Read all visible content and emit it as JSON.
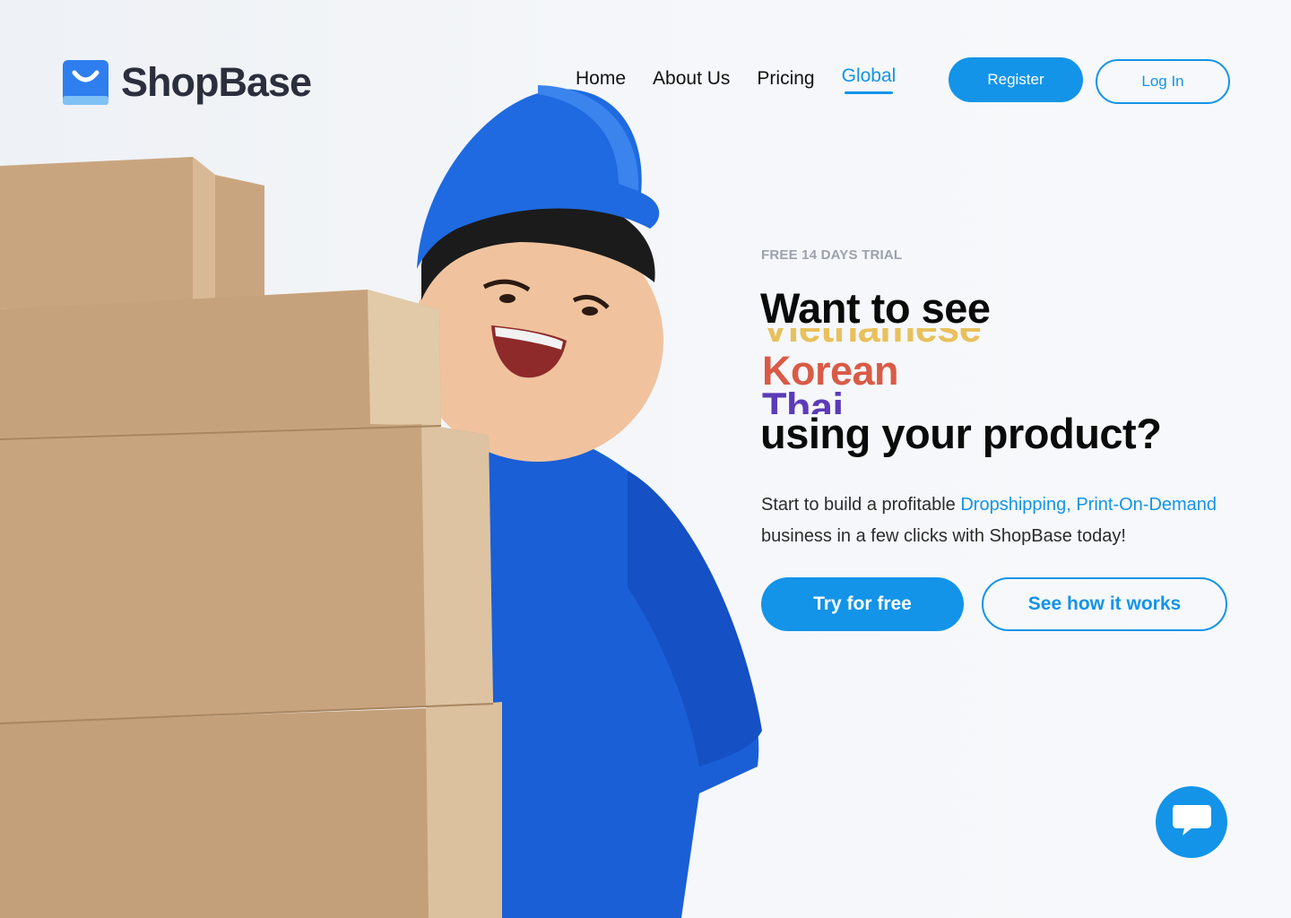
{
  "brand": {
    "name": "ShopBase",
    "accent": "#1394e8",
    "logo_icon": "shopping-bag-icon"
  },
  "nav": {
    "items": [
      {
        "label": "Home",
        "active": false
      },
      {
        "label": "About Us",
        "active": false
      },
      {
        "label": "Pricing",
        "active": false
      },
      {
        "label": "Global",
        "active": true
      }
    ]
  },
  "header": {
    "register_label": "Register",
    "login_label": "Log In"
  },
  "hero": {
    "eyebrow": "FREE 14 DAYS TRIAL",
    "headline_top": "Want to see",
    "rotating_words": [
      {
        "text": "Vietnamese",
        "color": "#e8c15c"
      },
      {
        "text": "Korean",
        "color": "#d95b46"
      },
      {
        "text": "Thai",
        "color": "#5b3bb8"
      }
    ],
    "headline_bottom": "using your product?",
    "desc_1": "Start to build a profitable ",
    "desc_hl": "Dropshipping, Print-On-Demand",
    "desc_2": " business in a few clicks with ShopBase today!",
    "cta_primary": "Try for free",
    "cta_secondary": "See how it works",
    "image": "delivery-person-holding-boxes"
  },
  "chat": {
    "icon": "chat-bubble-icon"
  }
}
